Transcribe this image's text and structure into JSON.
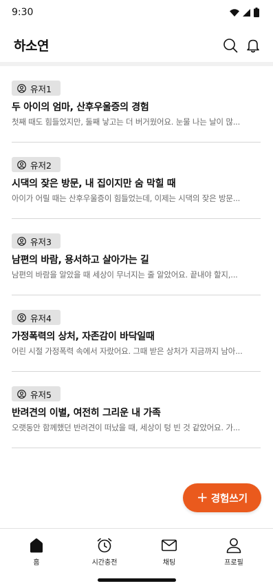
{
  "status_bar": {
    "time": "9:30",
    "icons": [
      "wifi-icon",
      "signal-icon",
      "battery-icon"
    ]
  },
  "header": {
    "title": "하소연",
    "icons": [
      "search-icon",
      "bell-icon"
    ]
  },
  "posts": [
    {
      "user": "유저1",
      "title": "두 아이의 엄마, 산후우울증의 경험",
      "preview": "첫째 때도 힘들었지만, 둘째 낳고는 더 버거웠어요. 눈물 나는 날이 많..."
    },
    {
      "user": "유저2",
      "title": "시댁의 잦은 방문, 내 집이지만 숨 막힐 때",
      "preview": "아이가 어릴 때는 산후우울증이 힘들었는데, 이제는 시댁의 잦은 방문..."
    },
    {
      "user": "유저3",
      "title": "남편의 바람, 용서하고 살아가는 길",
      "preview": "남편의 바람을 알았을 때 세상이 무너지는 줄 알았어요. 끝내야 할지,..."
    },
    {
      "user": "유저4",
      "title": "가정폭력의 상처, 자존감이 바닥일때",
      "preview": "어린 시절 가정폭력 속에서 자랐어요. 그때 받은 상처가 지금까지 남아..."
    },
    {
      "user": "유저5",
      "title": "반려견의 이별, 여전히 그리운 내 가족",
      "preview": "오랫동안 함께했던 반려견이 떠났을 때, 세상이 텅 빈 것 같았어요. 가..."
    }
  ],
  "fab": {
    "icon": "plus-icon",
    "label": "경험쓰기",
    "color": "#ea5a1d"
  },
  "bottom_nav": [
    {
      "label": "홈",
      "icon": "home-icon",
      "active": true
    },
    {
      "label": "시간충전",
      "icon": "alarm-clock-icon"
    },
    {
      "label": "채팅",
      "icon": "mail-icon"
    },
    {
      "label": "프로필",
      "icon": "person-icon"
    }
  ]
}
